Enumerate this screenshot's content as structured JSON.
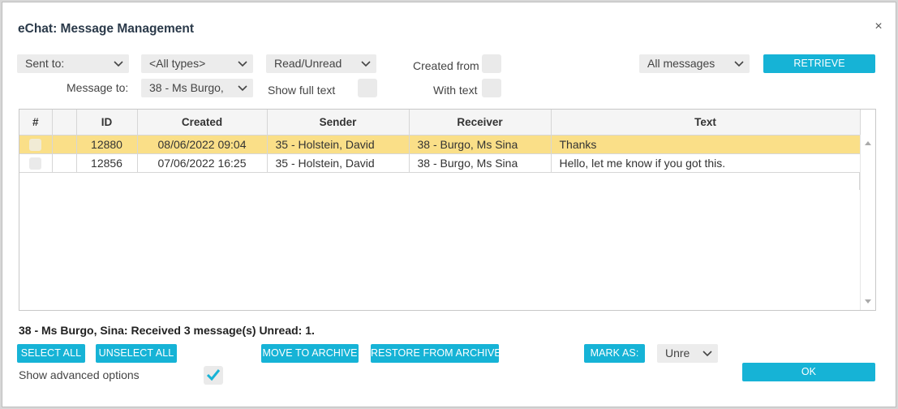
{
  "dialog": {
    "title": "eChat: Message Management",
    "close_glyph": "×"
  },
  "filters": {
    "sent_to": "Sent to:",
    "types": "<All types>",
    "read_unread": "Read/Unread",
    "created_from_label": "Created from",
    "all_messages": "All messages",
    "retrieve_label": "RETRIEVE",
    "message_to_label": "Message to:",
    "message_to_value": "38 - Ms Burgo,",
    "show_full_text_label": "Show full text",
    "with_text_label": "With text"
  },
  "table": {
    "headers": [
      "#",
      "",
      "ID",
      "Created",
      "Sender",
      "Receiver",
      "Text"
    ],
    "rows": [
      {
        "id": "12880",
        "created": "08/06/2022 09:04",
        "sender": "35 - Holstein, David",
        "receiver": "38 - Burgo, Ms Sina",
        "text": "Thanks",
        "selected": true
      },
      {
        "id": "12856",
        "created": "07/06/2022 16:25",
        "sender": "35 - Holstein, David",
        "receiver": "38 - Burgo, Ms Sina",
        "text": "Hello, let me know if you got this.",
        "selected": false
      }
    ]
  },
  "status_text": "38 - Ms Burgo, Sina: Received 3 message(s) Unread: 1.",
  "actions": {
    "select_all": "SELECT ALL",
    "unselect_all": "UNSELECT ALL",
    "move_to_archive": "MOVE TO ARCHIVE",
    "restore_from_archive": "RESTORE FROM ARCHIVE",
    "mark_as": "MARK AS:",
    "mark_as_value": "Unre",
    "ok": "OK"
  },
  "advanced": {
    "label": "Show advanced options",
    "checked": true
  },
  "colors": {
    "accent": "#16b3d6",
    "selected_row": "#fadf88"
  }
}
